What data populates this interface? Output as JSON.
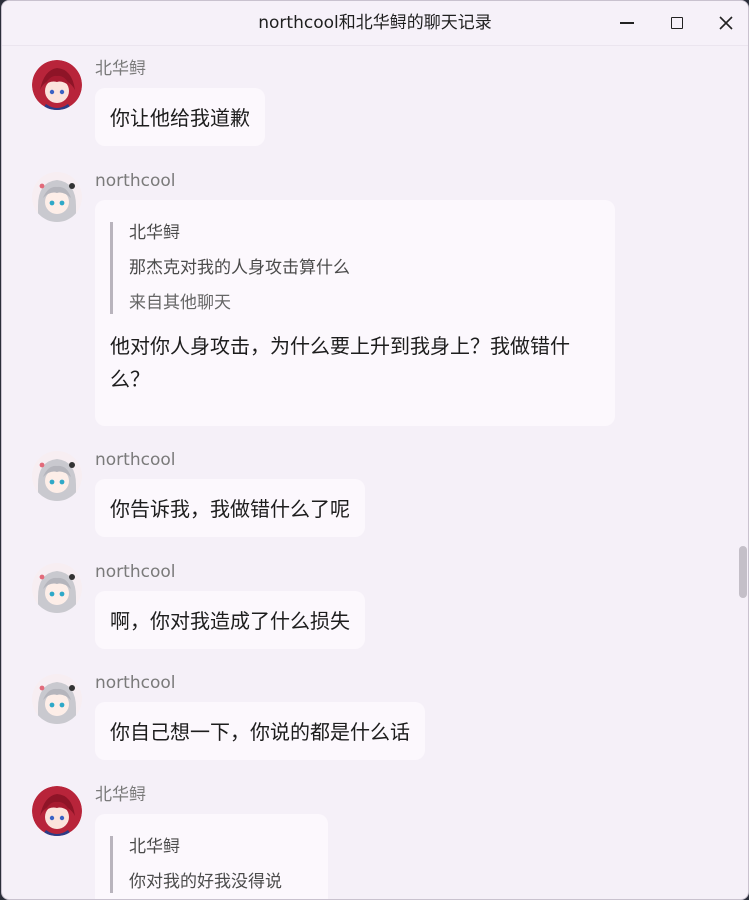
{
  "window": {
    "title": "northcool和北华鲟的聊天记录"
  },
  "colors": {
    "background": "#f5f0f8",
    "bubble": "#fcf8fd",
    "quote_bar": "#b9b4bd"
  },
  "messages": [
    {
      "sender": "北华鲟",
      "avatar": "red-haired-anime-avatar",
      "text": "你让他给我道歉"
    },
    {
      "sender": "northcool",
      "avatar": "silver-haired-anime-avatar",
      "quote": {
        "author": "北华鲟",
        "text": "那杰克对我的人身攻击算什么",
        "source": "来自其他聊天"
      },
      "text": "他对你人身攻击，为什么要上升到我身上？我做错什么？"
    },
    {
      "sender": "northcool",
      "avatar": "silver-haired-anime-avatar",
      "text": "你告诉我，我做错什么了呢"
    },
    {
      "sender": "northcool",
      "avatar": "silver-haired-anime-avatar",
      "text": "啊，你对我造成了什么损失"
    },
    {
      "sender": "northcool",
      "avatar": "silver-haired-anime-avatar",
      "text": "你自己想一下，你说的都是什么话"
    },
    {
      "sender": "北华鲟",
      "avatar": "red-haired-anime-avatar",
      "quote": {
        "author": "北华鲟",
        "text": "你对我的好我没得说"
      }
    }
  ]
}
